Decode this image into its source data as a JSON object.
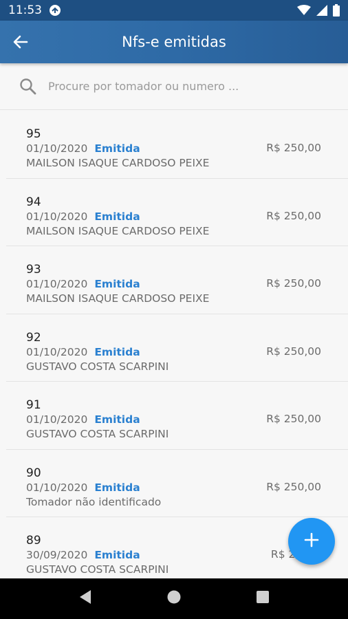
{
  "status_bar": {
    "time": "11:53",
    "icons": [
      "notification-icon",
      "wifi-icon",
      "signal-icon",
      "battery-icon"
    ]
  },
  "app_bar": {
    "title": "Nfs-e emitidas",
    "back_icon": "arrow-back-icon"
  },
  "search": {
    "placeholder": "Procure por tomador ou numero ...",
    "value": ""
  },
  "invoices": [
    {
      "number": "95",
      "date": "01/10/2020",
      "status": "Emitida",
      "client": "MAILSON ISAQUE CARDOSO PEIXE",
      "value": "R$ 250,00"
    },
    {
      "number": "94",
      "date": "01/10/2020",
      "status": "Emitida",
      "client": "MAILSON ISAQUE CARDOSO PEIXE",
      "value": "R$ 250,00"
    },
    {
      "number": "93",
      "date": "01/10/2020",
      "status": "Emitida",
      "client": "MAILSON ISAQUE CARDOSO PEIXE",
      "value": "R$ 250,00"
    },
    {
      "number": "92",
      "date": "01/10/2020",
      "status": "Emitida",
      "client": "GUSTAVO COSTA SCARPINI",
      "value": "R$ 250,00"
    },
    {
      "number": "91",
      "date": "01/10/2020",
      "status": "Emitida",
      "client": "GUSTAVO COSTA SCARPINI",
      "value": "R$ 250,00"
    },
    {
      "number": "90",
      "date": "01/10/2020",
      "status": "Emitida",
      "client": "Tomador não identificado",
      "value": "R$ 250,00"
    },
    {
      "number": "89",
      "date": "30/09/2020",
      "status": "Emitida",
      "client": "GUSTAVO COSTA SCARPINI",
      "value": "R$ 2,50"
    }
  ],
  "fab": {
    "icon": "plus-icon"
  },
  "colors": {
    "app_bar": "#2e6aa6",
    "status_bar": "#1e4f82",
    "status_text": "#2a80d0",
    "fab": "#2196f3"
  },
  "nav_bar": {
    "icons": [
      "back-triangle-icon",
      "home-circle-icon",
      "recents-square-icon"
    ]
  }
}
